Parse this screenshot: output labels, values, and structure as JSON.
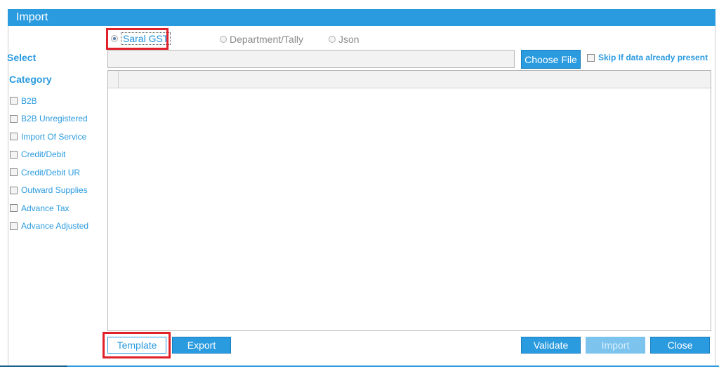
{
  "window": {
    "title": "Import"
  },
  "source_options": [
    {
      "label": "Saral GST",
      "selected": true
    },
    {
      "label": "Department/Tally",
      "selected": false
    },
    {
      "label": "Json",
      "selected": false
    }
  ],
  "select": {
    "label": "Select",
    "file_value": "",
    "choose_file_label": "Choose File",
    "skip_label": "Skip If data already present",
    "skip_checked": false
  },
  "category": {
    "label": "Category",
    "items": [
      {
        "label": "B2B",
        "checked": false
      },
      {
        "label": "B2B Unregistered",
        "checked": false
      },
      {
        "label": "Import Of Service",
        "checked": false
      },
      {
        "label": "Credit/Debit",
        "checked": false
      },
      {
        "label": "Credit/Debit UR",
        "checked": false
      },
      {
        "label": "Outward Supplies",
        "checked": false
      },
      {
        "label": "Advance Tax",
        "checked": false
      },
      {
        "label": "Advance Adjusted",
        "checked": false
      }
    ]
  },
  "footer": {
    "template_label": "Template",
    "export_label": "Export",
    "validate_label": "Validate",
    "import_label": "Import",
    "close_label": "Close"
  },
  "colors": {
    "accent": "#2b9be0",
    "highlight": "#e0212a"
  }
}
